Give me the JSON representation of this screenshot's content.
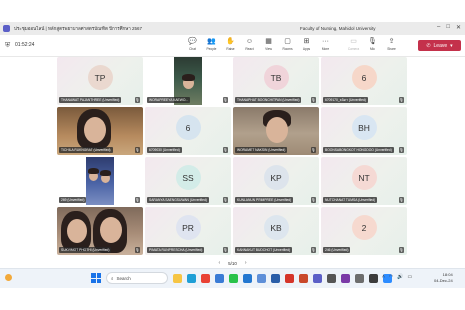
{
  "window": {
    "title": "ประชุมออนไลน์ | หลักสูตรพยาบาลศาสตรบัณฑิต ปีการศึกษา 2567",
    "org_label": "Faculty of Nursing, Mahidol University"
  },
  "toolbar": {
    "timer": "01:52:24",
    "items": [
      {
        "label": "Chat",
        "icon": "chat-icon",
        "glyph": "💬"
      },
      {
        "label": "People",
        "icon": "people-icon",
        "glyph": "👥"
      },
      {
        "label": "Raise",
        "icon": "raise-hand-icon",
        "glyph": "✋"
      },
      {
        "label": "React",
        "icon": "react-icon",
        "glyph": "☺"
      },
      {
        "label": "View",
        "icon": "view-icon",
        "glyph": "▦"
      },
      {
        "label": "Rooms",
        "icon": "rooms-icon",
        "glyph": "▢"
      },
      {
        "label": "Apps",
        "icon": "apps-icon",
        "glyph": "⊞"
      },
      {
        "label": "More",
        "icon": "more-icon",
        "glyph": "···"
      }
    ],
    "media": [
      {
        "label": "Camera",
        "icon": "camera-off-icon",
        "glyph": "▭",
        "disabled": true
      },
      {
        "label": "Mic",
        "icon": "mic-icon",
        "glyph": "🎙",
        "disabled": false
      },
      {
        "label": "Share",
        "icon": "share-icon",
        "glyph": "⇪",
        "disabled": false
      }
    ],
    "leave_label": "Leave"
  },
  "tiles": [
    {
      "type": "avatar",
      "initials": "TP",
      "name": "THANAWAT PAJANTHREE (Unverified)",
      "circle": "#ead8cf"
    },
    {
      "type": "camera",
      "name": "WORAPREEYA KAEWO...",
      "scene": "dark"
    },
    {
      "type": "avatar",
      "initials": "TB",
      "name": "THANAPHAT BOONCHITPAN (Unverified)",
      "circle": "#f0d4da"
    },
    {
      "type": "avatar",
      "initials": "6",
      "name": "6709170_ธนิดา (Unverified)",
      "circle": "#f6d7c9"
    },
    {
      "type": "camera",
      "name": "TICHILA RUKNGRAT (Unverified)",
      "scene": "girl"
    },
    {
      "type": "avatar",
      "initials": "6",
      "name": "6709030 (Unverified)",
      "circle": "#d6e4ef"
    },
    {
      "type": "camera",
      "name": "WORAMET NAKSIN (Unverified)",
      "scene": "room"
    },
    {
      "type": "avatar",
      "initials": "BH",
      "name": "BOONSABONGKOT HONGDOO (Unverified)",
      "circle": "#d9e6f2"
    },
    {
      "type": "camera",
      "name": "269 (Unverified)",
      "scene": "two"
    },
    {
      "type": "avatar",
      "initials": "SS",
      "name": "SARANYA SAENGSUWAN (Unverified)",
      "circle": "#d3ece8"
    },
    {
      "type": "avatar",
      "initials": "KP",
      "name": "KUNLANUN PRIMPREE (Unverified)",
      "circle": "#dde4ec"
    },
    {
      "type": "avatar",
      "initials": "NT",
      "name": "NUTCHANAT TUMSA (Unverified)",
      "circle": "#f5d9d4"
    },
    {
      "type": "camera",
      "name": "SUKVIMOT PHOTHI (Unverified)",
      "scene": "girls"
    },
    {
      "type": "avatar",
      "initials": "PR",
      "name": "PIMATA RUNPRESCHA (Unverified)",
      "circle": "#dfe4f0"
    },
    {
      "type": "avatar",
      "initials": "KB",
      "name": "KANNAKUT BUDCHOT (Unverified)",
      "circle": "#dde6ee"
    },
    {
      "type": "avatar",
      "initials": "2",
      "name": "246 (Unverified)",
      "circle": "#f6d9cf"
    }
  ],
  "pager": {
    "label": "5/10"
  },
  "taskbar": {
    "weather": "",
    "search_placeholder": "Search",
    "clock_time": "18:04",
    "clock_date": "04-Dec-24",
    "apps": [
      {
        "icon": "file-explorer-icon",
        "color": "#f6c544"
      },
      {
        "icon": "edge-icon",
        "color": "#1f9fd6"
      },
      {
        "icon": "chrome-icon",
        "color": "#e94235"
      },
      {
        "icon": "store-icon",
        "color": "#3a7bd5"
      },
      {
        "icon": "line-icon",
        "color": "#29c24a"
      },
      {
        "icon": "mail-icon",
        "color": "#2377d0"
      },
      {
        "icon": "photos-icon",
        "color": "#5e8fd8"
      },
      {
        "icon": "word-icon",
        "color": "#2b5ea8"
      },
      {
        "icon": "acrobat-icon",
        "color": "#d5352a"
      },
      {
        "icon": "powerpoint-icon",
        "color": "#c9482b"
      },
      {
        "icon": "teams-icon",
        "color": "#5b5fc7"
      },
      {
        "icon": "camera-app-icon",
        "color": "#555555"
      },
      {
        "icon": "onenote-icon",
        "color": "#7b3aa7"
      },
      {
        "icon": "settings-icon",
        "color": "#6d6d6d"
      },
      {
        "icon": "app-icon",
        "color": "#3c3c3c"
      },
      {
        "icon": "zoom-icon",
        "color": "#2d8cff"
      }
    ]
  }
}
